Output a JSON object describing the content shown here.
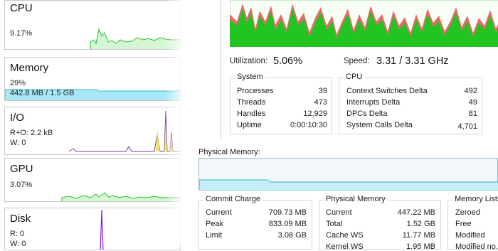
{
  "sidebar": {
    "cpu": {
      "title": "CPU",
      "value": "9.17%"
    },
    "memory": {
      "title": "Memory",
      "percent": "29%",
      "usage": "442.8 MB / 1.5 GB",
      "fill_fraction": 0.29
    },
    "io": {
      "title": "I/O",
      "line1": "R+O: 2.2 kB",
      "line2": "W: 0"
    },
    "gpu": {
      "title": "GPU",
      "value": "3.07%"
    },
    "disk": {
      "title": "Disk",
      "line1": "R: 0",
      "line2": "W: 0"
    }
  },
  "cpu_panel": {
    "utilization_label": "Utilization:",
    "utilization_value": "5.06%",
    "speed_label": "Speed:",
    "speed_value": "3.31 / 3.31 GHz",
    "system": {
      "title": "System",
      "rows": [
        {
          "label": "Processes",
          "value": "39"
        },
        {
          "label": "Threads",
          "value": "473"
        },
        {
          "label": "Handles",
          "value": "12,929"
        },
        {
          "label": "Uptime",
          "value": "0:00:10:30"
        }
      ]
    },
    "cpu": {
      "title": "CPU",
      "rows": [
        {
          "label": "Context Switches Delta",
          "value": "492"
        },
        {
          "label": "Interrupts Delta",
          "value": "49"
        },
        {
          "label": "DPCs Delta",
          "value": "81"
        },
        {
          "label": "System Calls Delta",
          "value": "4,701"
        }
      ]
    }
  },
  "memory_panel": {
    "physical_memory_label": "Physical Memory:",
    "commit": {
      "title": "Commit Charge",
      "rows": [
        {
          "label": "Current",
          "value": "709.73 MB"
        },
        {
          "label": "Peak",
          "value": "833.09 MB"
        },
        {
          "label": "Limit",
          "value": "3.08 GB"
        }
      ]
    },
    "physical": {
      "title": "Physical Memory",
      "rows": [
        {
          "label": "Current",
          "value": "447.22 MB"
        },
        {
          "label": "Total",
          "value": "1.52 GB"
        },
        {
          "label": "Cache WS",
          "value": "11.77 MB"
        },
        {
          "label": "Kernel WS",
          "value": "1.95 MB"
        }
      ]
    },
    "lists": {
      "title": "Memory Lists",
      "rows": [
        "Zeroed",
        "Free",
        "Modified",
        "Modified no..."
      ]
    }
  },
  "colors": {
    "cpu_fill": "#22c422",
    "cpu_kernel": "#e23b3b",
    "memory_fill": "#a6e8f5",
    "io_line": "#7a3fa0",
    "io_fill": "#e9e34b",
    "disk_line": "#8a1fd1"
  }
}
